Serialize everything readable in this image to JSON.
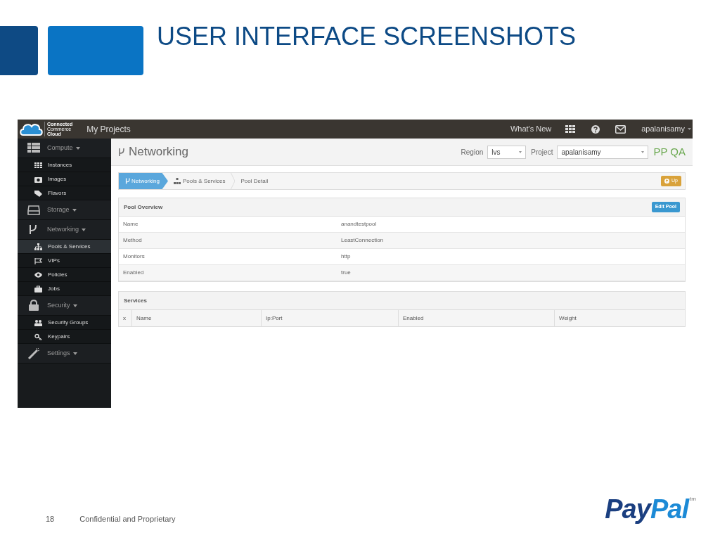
{
  "slide": {
    "title": "USER INTERFACE SCREENSHOTS",
    "page_number": "18",
    "footer": "Confidential and Proprietary",
    "logo_parts": [
      "Pay",
      "Pal"
    ],
    "logo_mark": "tm"
  },
  "app": {
    "topbar": {
      "brand_lines": [
        "Connected",
        "Commerce",
        "Cloud"
      ],
      "nav": "My Projects",
      "whats_new": "What's New",
      "user": "apalanisamy"
    },
    "sidebar": [
      {
        "label": "Compute",
        "children": [
          {
            "label": "Instances",
            "selected": false
          },
          {
            "label": "Images",
            "selected": false
          },
          {
            "label": "Flavors",
            "selected": false
          }
        ]
      },
      {
        "label": "Storage"
      },
      {
        "label": "Networking",
        "children": [
          {
            "label": "Pools & Services",
            "selected": true
          },
          {
            "label": "VIPs",
            "selected": false
          },
          {
            "label": "Policies",
            "selected": false
          },
          {
            "label": "Jobs",
            "selected": false
          }
        ]
      },
      {
        "label": "Security",
        "children": [
          {
            "label": "Security Groups",
            "selected": false
          },
          {
            "label": "Keypairs",
            "selected": false
          }
        ]
      },
      {
        "label": "Settings"
      }
    ],
    "header": {
      "title": "Networking",
      "region_label": "Region",
      "region": "lvs",
      "project_label": "Project",
      "project": "apalanisamy",
      "environment": "PP QA"
    },
    "breadcrumb": [
      {
        "label": "Networking",
        "selected": true
      },
      {
        "label": "Pools & Services",
        "selected": false
      },
      {
        "label": "Pool Detail",
        "selected": false
      }
    ],
    "up_button": "Up",
    "pool_overview": {
      "title": "Pool Overview",
      "button": "Edit Pool",
      "rows": [
        {
          "label": "Name",
          "value": "anandtestpool"
        },
        {
          "label": "Method",
          "value": "LeastConnection"
        },
        {
          "label": "Monitors",
          "value": "http"
        },
        {
          "label": "Enabled",
          "value": "true"
        }
      ]
    },
    "services": {
      "title": "Services",
      "columns": [
        "x",
        "Name",
        "Ip:Port",
        "Enabled",
        "Weight"
      ]
    }
  }
}
